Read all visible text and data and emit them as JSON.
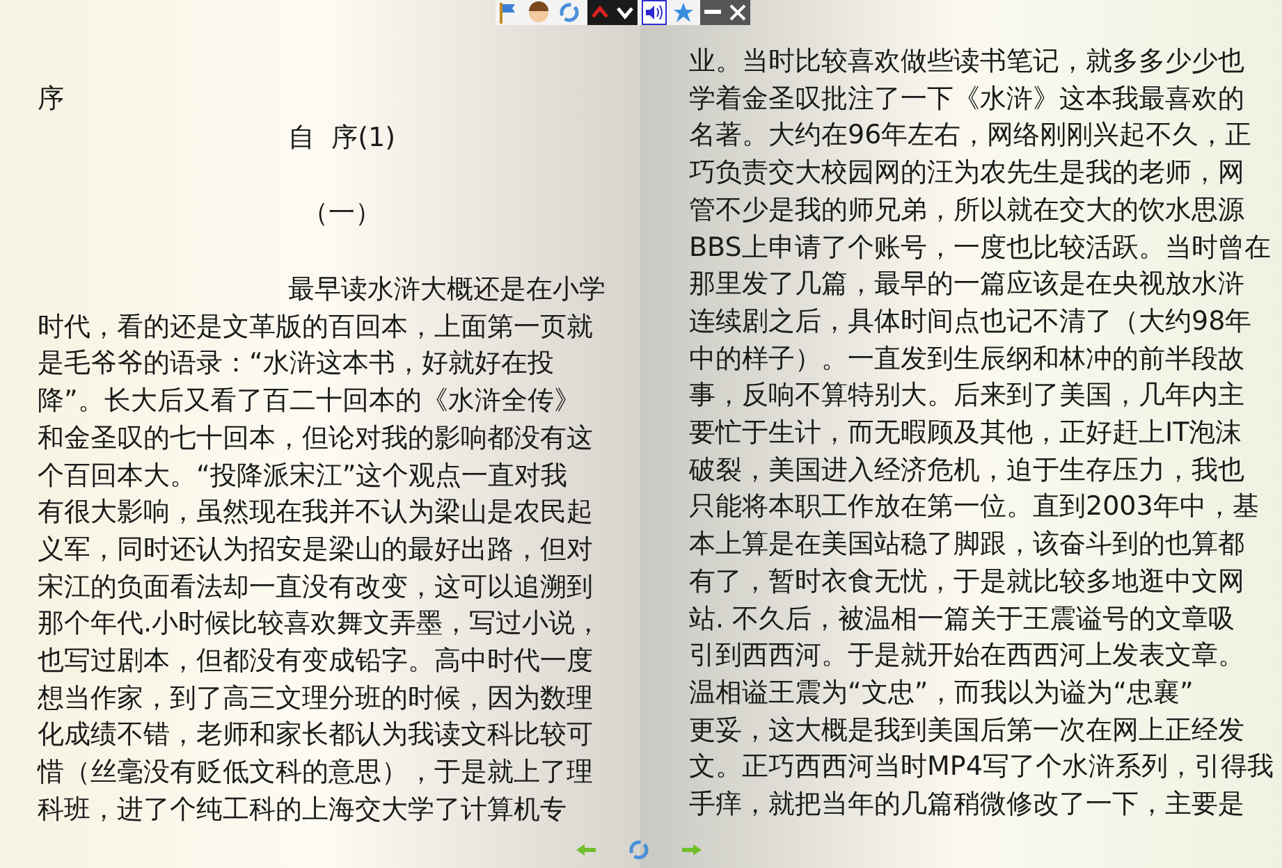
{
  "left_page": {
    "heading": "序",
    "title": "自  序(1)",
    "section": "（一）",
    "paragraph_lines": [
      "最早读水浒大概还是在小学",
      "时代，看的还是文革版的百回本，上面第一页就",
      "是毛爷爷的语录：“水浒这本书，好就好在投",
      "降”。长大后又看了百二十回本的《水浒全传》",
      "和金圣叹的七十回本，但论对我的影响都没有这",
      "个百回本大。“投降派宋江”这个观点一直对我",
      "有很大影响，虽然现在我并不认为梁山是农民起",
      "义军，同时还认为招安是梁山的最好出路，但对",
      "宋江的负面看法却一直没有改变，这可以追溯到",
      "那个年代.小时候比较喜欢舞文弄墨，写过小说，",
      "也写过剧本，但都没有变成铅字。高中时代一度",
      "想当作家，到了高三文理分班的时候，因为数理",
      "化成绩不错，老师和家长都认为我读文科比较可",
      "惜（丝毫没有贬低文科的意思），于是就上了理",
      "科班，进了个纯工科的上海交大学了计算机专"
    ]
  },
  "right_page": {
    "lines": [
      "业。当时比较喜欢做些读书笔记，就多多少少也",
      "学着金圣叹批注了一下《水浒》这本我最喜欢的",
      "名著。大约在96年左右，网络刚刚兴起不久，正",
      "巧负责交大校园网的汪为农先生是我的老师，网",
      "管不少是我的师兄弟，所以就在交大的饮水思源",
      "BBS上申请了个账号，一度也比较活跃。当时曾在",
      "那里发了几篇，最早的一篇应该是在央视放水浒",
      "连续剧之后，具体时间点也记不清了（大约98年",
      "中的样子）。一直发到生辰纲和林冲的前半段故",
      "事，反响不算特别大。后来到了美国，几年内主",
      "要忙于生计，而无暇顾及其他，正好赶上IT泡沫",
      "破裂，美国进入经济危机，迫于生存压力，我也",
      "只能将本职工作放在第一位。直到2003年中，基",
      "本上算是在美国站稳了脚跟，该奋斗到的也算都",
      "有了，暂时衣食无忧，于是就比较多地逛中文网",
      "站. 不久后，被温相一篇关于王震谥号的文章吸",
      "引到西西河。于是就开始在西西河上发表文章。",
      "温相谥王震为“文忠”，而我以为谥为“忠襄”",
      "更妥，这大概是我到美国后第一次在网上正经发",
      "文。正巧西西河当时MP4写了个水浒系列，引得我",
      "手痒，就把当年的几篇稍微修改了一下，主要是"
    ]
  }
}
